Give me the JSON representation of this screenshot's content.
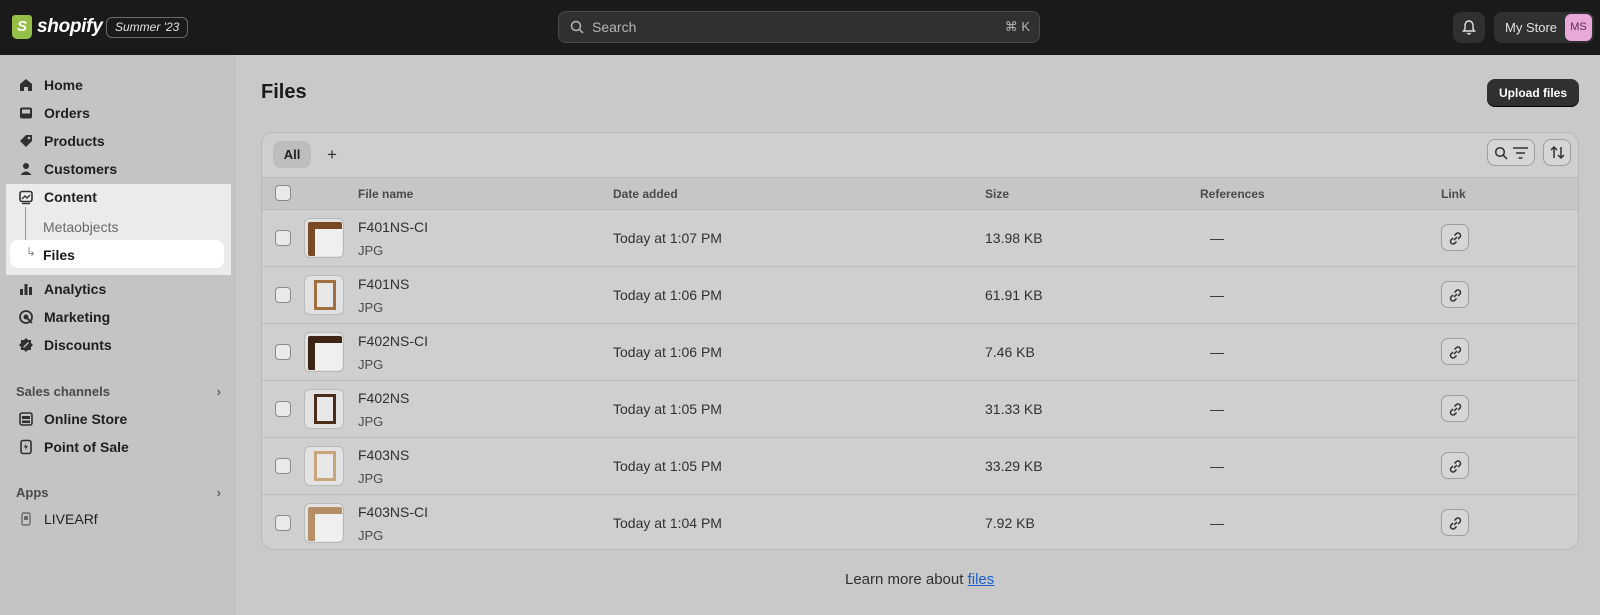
{
  "topbar": {
    "brand": "shopify",
    "edition": "Summer '23",
    "search_placeholder": "Search",
    "search_shortcut": "⌘ K",
    "store_name": "My Store",
    "avatar_initials": "MS"
  },
  "sidebar": {
    "items": [
      {
        "label": "Home",
        "icon": "home-icon"
      },
      {
        "label": "Orders",
        "icon": "inbox-icon"
      },
      {
        "label": "Products",
        "icon": "tag-icon"
      },
      {
        "label": "Customers",
        "icon": "person-icon"
      },
      {
        "label": "Content",
        "icon": "image-icon"
      },
      {
        "label": "Analytics",
        "icon": "bar-chart-icon"
      },
      {
        "label": "Marketing",
        "icon": "target-icon"
      },
      {
        "label": "Discounts",
        "icon": "discount-icon"
      }
    ],
    "content_sub": [
      "Metaobjects",
      "Files"
    ],
    "sales_channels": {
      "title": "Sales channels",
      "items": [
        {
          "label": "Online Store",
          "icon": "store-icon"
        },
        {
          "label": "Point of Sale",
          "icon": "pos-icon"
        }
      ]
    },
    "apps": {
      "title": "Apps",
      "items": [
        {
          "label": "LIVEARf",
          "icon": "app-icon"
        }
      ]
    }
  },
  "main": {
    "title": "Files",
    "upload_label": "Upload files",
    "tabs": [
      "All",
      "+"
    ],
    "columns": [
      "File name",
      "Date added",
      "Size",
      "References",
      "Link"
    ],
    "rows": [
      {
        "name": "F401NS-CI",
        "type": "JPG",
        "date": "Today at 1:07 PM",
        "size": "13.98 KB",
        "refs": "—",
        "thumb": "corner"
      },
      {
        "name": "F401NS",
        "type": "JPG",
        "date": "Today at 1:06 PM",
        "size": "61.91 KB",
        "refs": "—",
        "thumb": "frame"
      },
      {
        "name": "F402NS-CI",
        "type": "JPG",
        "date": "Today at 1:06 PM",
        "size": "7.46 KB",
        "refs": "—",
        "thumb": "corner-dark"
      },
      {
        "name": "F402NS",
        "type": "JPG",
        "date": "Today at 1:05 PM",
        "size": "31.33 KB",
        "refs": "—",
        "thumb": "frame-dark"
      },
      {
        "name": "F403NS",
        "type": "JPG",
        "date": "Today at 1:05 PM",
        "size": "33.29 KB",
        "refs": "—",
        "thumb": "frame-pale"
      },
      {
        "name": "F403NS-CI",
        "type": "JPG",
        "date": "Today at 1:04 PM",
        "size": "7.92 KB",
        "refs": "—",
        "thumb": "corner-pale"
      }
    ],
    "learn_prefix": "Learn more about",
    "learn_link": "files"
  }
}
